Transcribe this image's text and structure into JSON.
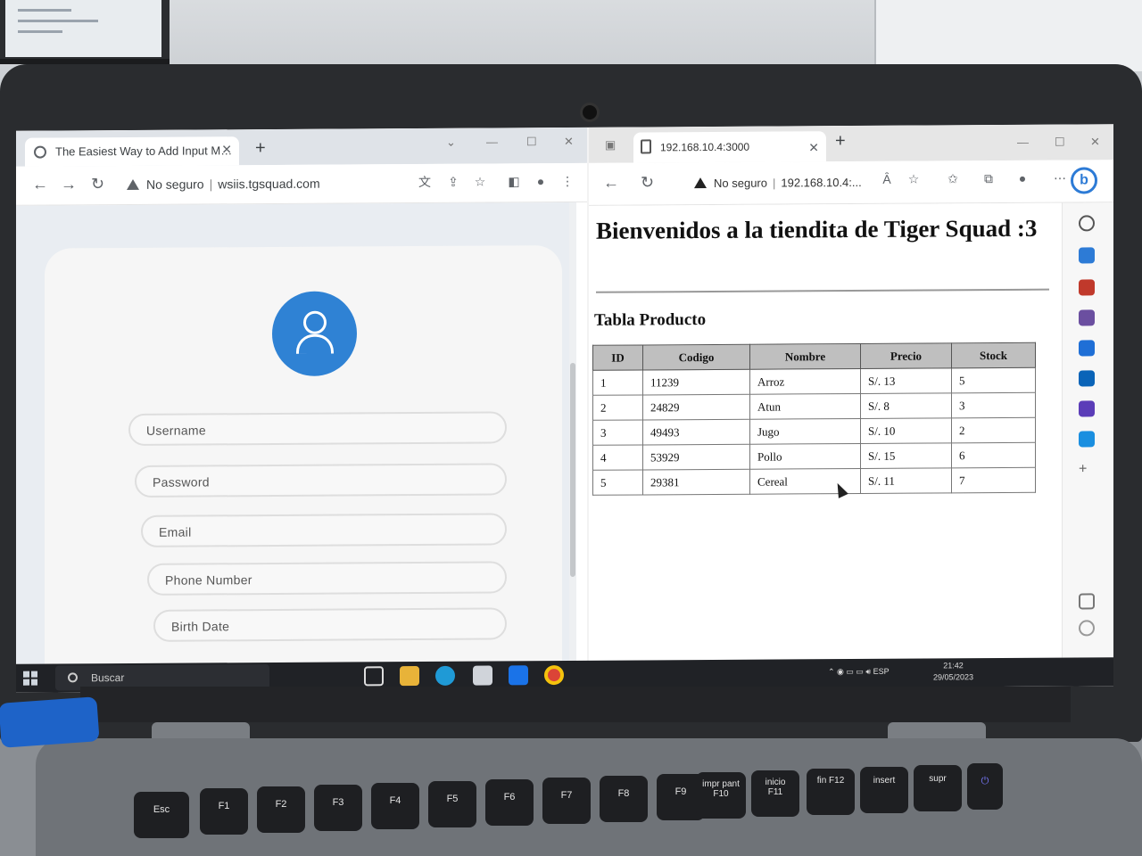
{
  "left_browser": {
    "tab_title": "The Easiest Way to Add Input M…",
    "security_label": "No seguro",
    "url": "wsiis.tgsquad.com",
    "form": {
      "fields": [
        "Username",
        "Password",
        "Email",
        "Phone Number",
        "Birth Date"
      ]
    }
  },
  "right_browser": {
    "tab_title": "192.168.10.4:3000",
    "security_label": "No seguro",
    "url": "192.168.10.4:...",
    "read_aloud_label": "Ȃ",
    "page": {
      "heading": "Bienvenidos a la tiendita de Tiger Squad :3",
      "table_title": "Tabla Producto",
      "columns": [
        "ID",
        "Codigo",
        "Nombre",
        "Precio",
        "Stock"
      ],
      "rows": [
        [
          "1",
          "11239",
          "Arroz",
          "S/. 13",
          "5"
        ],
        [
          "2",
          "24829",
          "Atun",
          "S/. 8",
          "3"
        ],
        [
          "3",
          "49493",
          "Jugo",
          "S/. 10",
          "2"
        ],
        [
          "4",
          "53929",
          "Pollo",
          "S/. 15",
          "6"
        ],
        [
          "5",
          "29381",
          "Cereal",
          "S/. 11",
          "7"
        ]
      ]
    }
  },
  "taskbar": {
    "search_placeholder": "Buscar",
    "language": "ESP",
    "time": "21:42",
    "date": "29/05/2023"
  },
  "keyboard": {
    "keys": [
      "Esc",
      "F1",
      "F2",
      "F3",
      "F4",
      "F5",
      "F6",
      "F7",
      "F8",
      "F9",
      "impr pant F10",
      "inicio F11",
      "fin F12",
      "insert",
      "supr"
    ]
  },
  "colors": {
    "avatar_blue": "#2f82d4",
    "table_header": "#bfbfbf",
    "taskbar": "#202226"
  }
}
